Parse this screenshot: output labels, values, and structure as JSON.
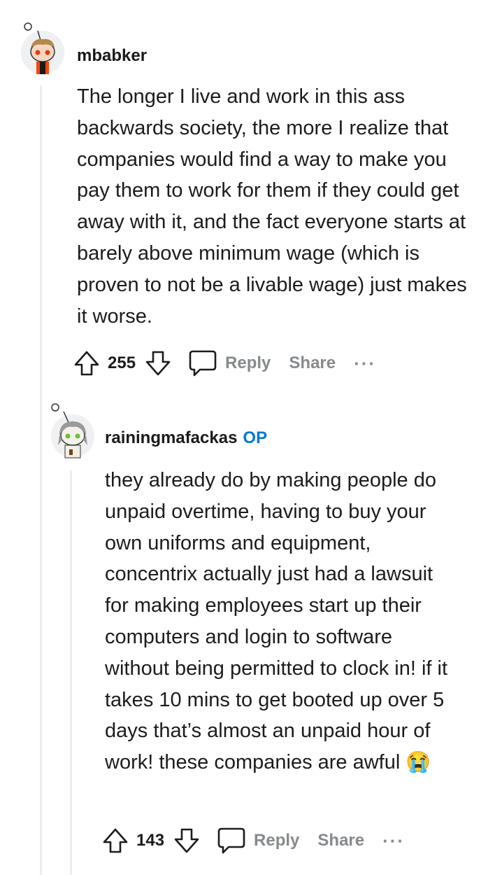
{
  "comments": [
    {
      "username": "mbabker",
      "is_op": false,
      "body": "The longer I live and work in this ass backwards society, the more I realize that companies would find a way to make you pay them to work for them if they could get away with it, and the fact everyone starts at barely above minimum wage (which is proven to not be a livable wage) just makes it worse.",
      "score": "255",
      "reply_label": "Reply",
      "share_label": "Share",
      "more_label": "···"
    },
    {
      "username": "rainingmafackas",
      "op_label": "OP",
      "is_op": true,
      "body": "they already do by making people do unpaid overtime, having to buy your own uniforms and equipment, concentrix actually just had a lawsuit for making employees start up their computers and login to software without being permitted to clock in! if it takes 10 mins to get booted up over 5 days that’s almost an unpaid hour of work! these companies are awful 😭",
      "score": "143",
      "reply_label": "Reply",
      "share_label": "Share",
      "more_label": "···"
    }
  ],
  "colors": {
    "op": "#0079d3",
    "muted": "#878a8c",
    "thread_line": "#ececec"
  }
}
